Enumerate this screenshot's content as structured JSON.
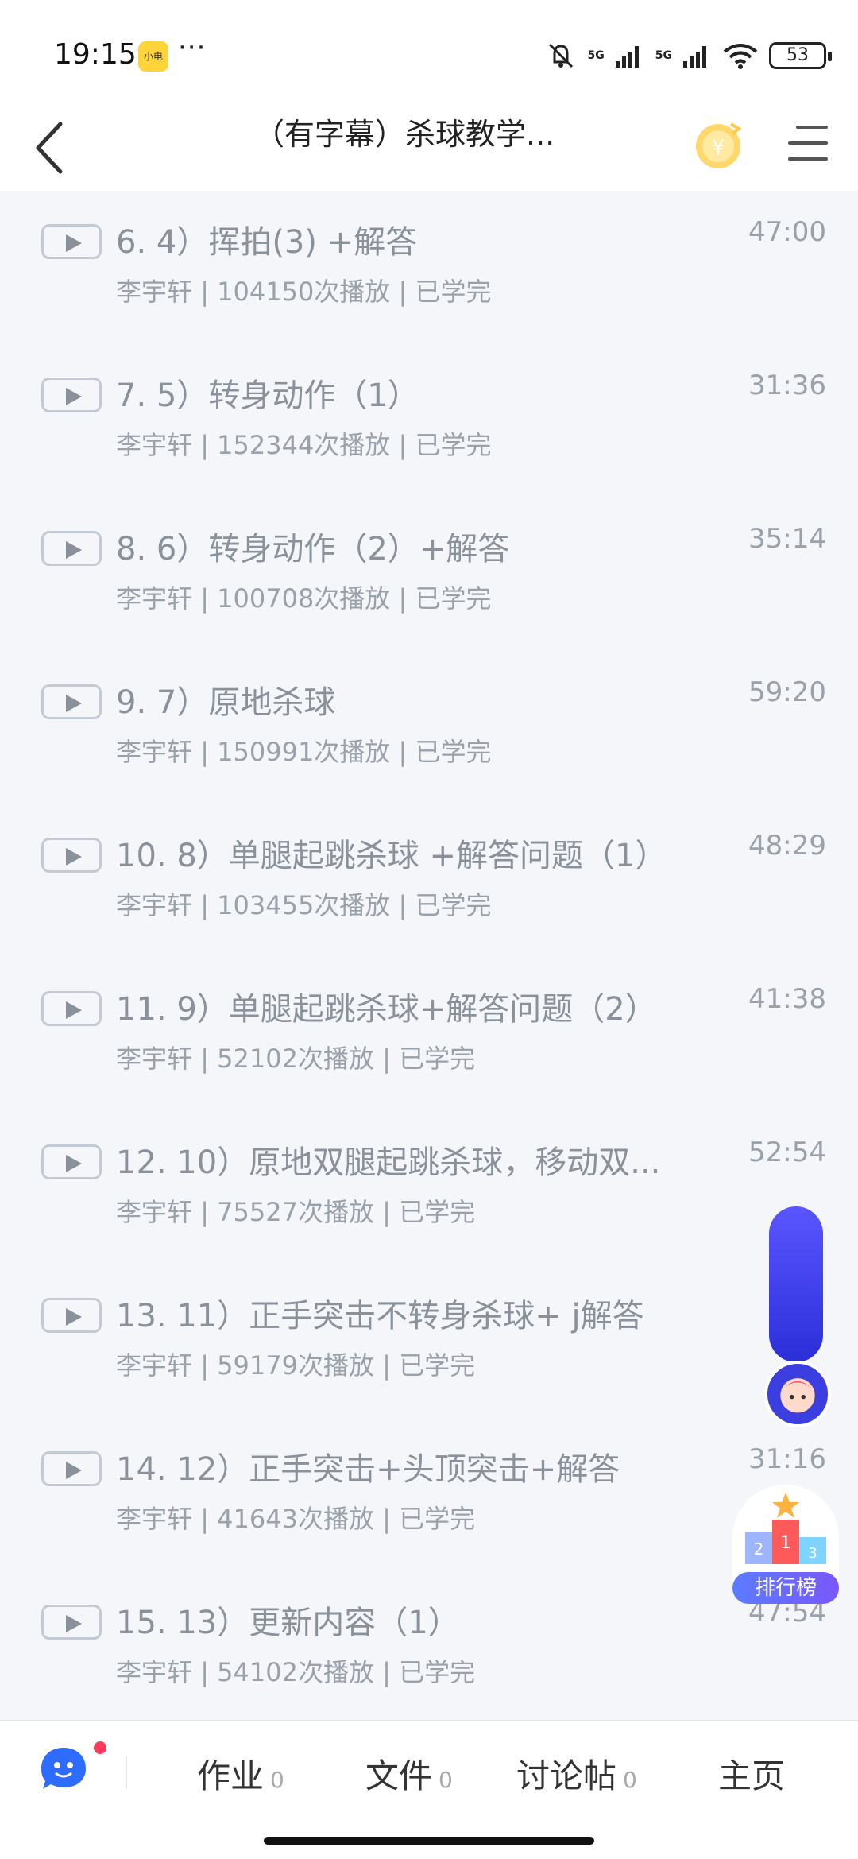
{
  "status_bar": {
    "time": "19:15",
    "app_badge": "小电",
    "more": "···",
    "network_1": "5G",
    "network_2": "5G",
    "battery": "53"
  },
  "header": {
    "title": "（有字幕）杀球教学..."
  },
  "lessons": [
    {
      "title": "6. 4）挥拍(3) +解答",
      "author": "李宇轩",
      "plays": "104150次播放",
      "status": "已学完",
      "duration": "47:00"
    },
    {
      "title": "7. 5）转身动作（1）",
      "author": "李宇轩",
      "plays": "152344次播放",
      "status": "已学完",
      "duration": "31:36"
    },
    {
      "title": "8. 6）转身动作（2）+解答",
      "author": "李宇轩",
      "plays": "100708次播放",
      "status": "已学完",
      "duration": "35:14"
    },
    {
      "title": "9. 7）原地杀球",
      "author": "李宇轩",
      "plays": "150991次播放",
      "status": "已学完",
      "duration": "59:20"
    },
    {
      "title": "10. 8）单腿起跳杀球 +解答问题（1）",
      "author": "李宇轩",
      "plays": "103455次播放",
      "status": "已学完",
      "duration": "48:29"
    },
    {
      "title": "11. 9）单腿起跳杀球+解答问题（2）",
      "author": "李宇轩",
      "plays": "52102次播放",
      "status": "已学完",
      "duration": "41:38"
    },
    {
      "title": "12. 10）原地双腿起跳杀球，移动双...",
      "author": "李宇轩",
      "plays": "75527次播放",
      "status": "已学完",
      "duration": "52:54"
    },
    {
      "title": "13. 11）正手突击不转身杀球+ j解答",
      "author": "李宇轩",
      "plays": "59179次播放",
      "status": "已学完",
      "duration": ""
    },
    {
      "title": "14. 12）正手突击+头顶突击+解答",
      "author": "李宇轩",
      "plays": "41643次播放",
      "status": "已学完",
      "duration": "31:16"
    },
    {
      "title": "15. 13）更新内容（1）",
      "author": "李宇轩",
      "plays": "54102次播放",
      "status": "已学完",
      "duration": "47:54"
    }
  ],
  "ranking": {
    "label": "排行榜"
  },
  "bottom_bar": {
    "homework": {
      "label": "作业",
      "count": "0"
    },
    "files": {
      "label": "文件",
      "count": "0"
    },
    "discussion": {
      "label": "讨论帖",
      "count": "0"
    },
    "home": {
      "label": "主页"
    }
  },
  "colors": {
    "accent": "#3b3fe0",
    "text_muted": "#8a919b",
    "background": "#f4f6f9"
  }
}
